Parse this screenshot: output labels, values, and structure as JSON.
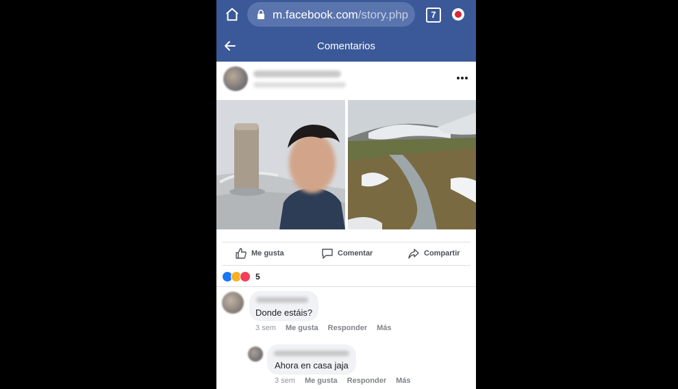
{
  "browser": {
    "url_main": "m.facebook.com",
    "url_path": "/story.php",
    "tab_count": "7"
  },
  "header": {
    "title": "Comentarios"
  },
  "post": {
    "actions": {
      "like": "Me gusta",
      "comment": "Comentar",
      "share": "Compartir"
    },
    "reaction_count": "5"
  },
  "comments": [
    {
      "text": "Donde estáis?",
      "time": "3 sem",
      "like": "Me gusta",
      "reply": "Responder",
      "more": "Más"
    },
    {
      "text": "Ahora en casa jaja",
      "time": "3 sem",
      "like": "Me gusta",
      "reply": "Responder",
      "more": "Más"
    }
  ],
  "colors": {
    "brand": "#3b5998",
    "bubble": "#f0f2f5"
  }
}
